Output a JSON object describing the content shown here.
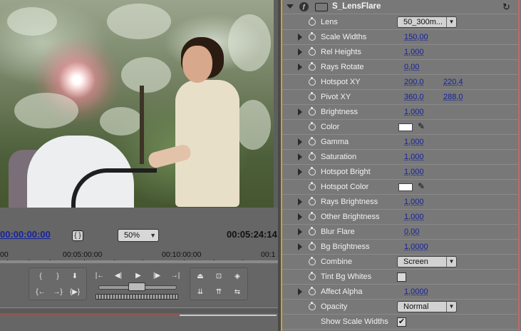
{
  "monitor": {
    "timecode_current": "00:00:00:00",
    "zoom": "50%",
    "timecode_duration": "00:05:24:14",
    "ruler_labels": [
      "00",
      "00:05:00:00",
      "00:10:00:00",
      "00:1"
    ]
  },
  "effect": {
    "name": "S_LensFlare",
    "params": [
      {
        "name": "Lens",
        "kind": "dropdown",
        "value": "50_300m...",
        "expandable": false
      },
      {
        "name": "Scale Widths",
        "kind": "number",
        "value": "150,00",
        "expandable": true
      },
      {
        "name": "Rel Heights",
        "kind": "number",
        "value": "1,000",
        "expandable": true
      },
      {
        "name": "Rays Rotate",
        "kind": "number",
        "value": "0,00",
        "expandable": true
      },
      {
        "name": "Hotspot XY",
        "kind": "xy",
        "value": "200,0",
        "value2": "220,4",
        "expandable": false
      },
      {
        "name": "Pivot XY",
        "kind": "xy",
        "value": "360,0",
        "value2": "288,0",
        "expandable": false
      },
      {
        "name": "Brightness",
        "kind": "number",
        "value": "1,000",
        "expandable": true
      },
      {
        "name": "Color",
        "kind": "color",
        "value": "#ffffff",
        "expandable": false
      },
      {
        "name": "Gamma",
        "kind": "number",
        "value": "1,000",
        "expandable": true
      },
      {
        "name": "Saturation",
        "kind": "number",
        "value": "1,000",
        "expandable": true
      },
      {
        "name": "Hotspot Bright",
        "kind": "number",
        "value": "1,000",
        "expandable": true
      },
      {
        "name": "Hotspot Color",
        "kind": "color",
        "value": "#ffffff",
        "expandable": false
      },
      {
        "name": "Rays Brightness",
        "kind": "number",
        "value": "1,000",
        "expandable": true
      },
      {
        "name": "Other Brightness",
        "kind": "number",
        "value": "1,000",
        "expandable": true
      },
      {
        "name": "Blur Flare",
        "kind": "number",
        "value": "0,00",
        "expandable": true
      },
      {
        "name": "Bg Brightness",
        "kind": "number",
        "value": "1,0000",
        "expandable": true
      },
      {
        "name": "Combine",
        "kind": "dropdown",
        "value": "Screen",
        "expandable": false
      },
      {
        "name": "Tint Bg Whites",
        "kind": "checkbox",
        "value": false,
        "expandable": false
      },
      {
        "name": "Affect Alpha",
        "kind": "number",
        "value": "1,0000",
        "expandable": true
      },
      {
        "name": "Opacity",
        "kind": "dropdown",
        "value": "Normal",
        "expandable": false
      },
      {
        "name": "Show Scale Widths",
        "kind": "checkbox",
        "value": true,
        "expandable": false
      }
    ]
  },
  "icons": {
    "fit": "fit-icon",
    "eyedropper": "eyedropper-icon",
    "reset": "reset-icon",
    "stopwatch": "stopwatch-icon"
  },
  "colors": {
    "timecode_blue": "#16249e",
    "link_blue": "#14229a",
    "panel_border": "#d0a02b",
    "timebar_red": "#c8413a"
  }
}
